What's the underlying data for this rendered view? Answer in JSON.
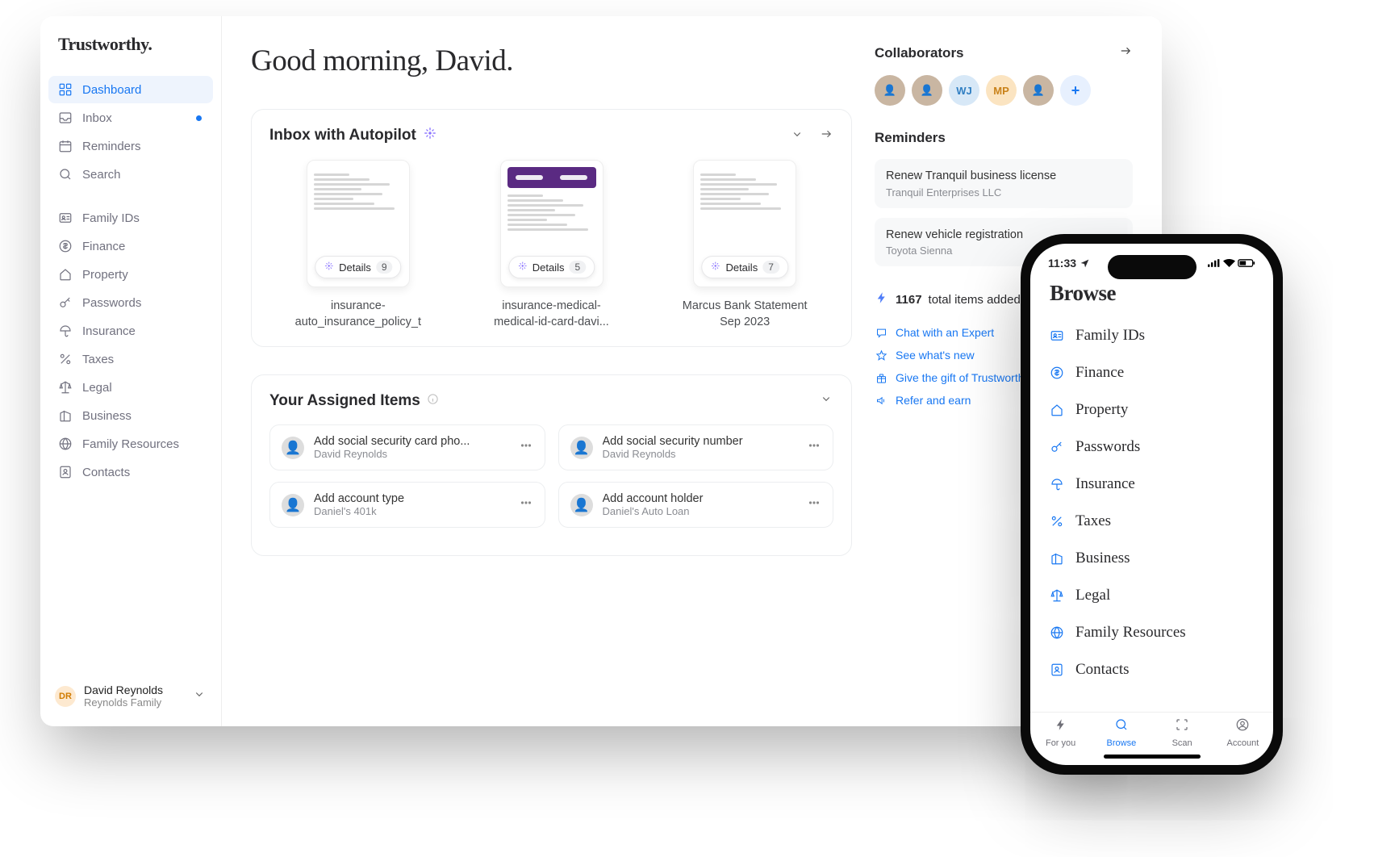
{
  "logo": "Trustworthy.",
  "sidebar": {
    "groups": [
      [
        {
          "icon": "grid",
          "label": "Dashboard",
          "active": true
        },
        {
          "icon": "inbox",
          "label": "Inbox",
          "dot": true
        },
        {
          "icon": "calendar",
          "label": "Reminders"
        },
        {
          "icon": "search",
          "label": "Search"
        }
      ],
      [
        {
          "icon": "id",
          "label": "Family IDs"
        },
        {
          "icon": "dollar",
          "label": "Finance"
        },
        {
          "icon": "home",
          "label": "Property"
        },
        {
          "icon": "key",
          "label": "Passwords"
        },
        {
          "icon": "umbrella",
          "label": "Insurance"
        },
        {
          "icon": "percent",
          "label": "Taxes"
        },
        {
          "icon": "scale",
          "label": "Legal"
        },
        {
          "icon": "building",
          "label": "Business"
        },
        {
          "icon": "globe",
          "label": "Family Resources"
        },
        {
          "icon": "contacts",
          "label": "Contacts"
        }
      ]
    ],
    "user": {
      "initials": "DR",
      "name": "David Reynolds",
      "sub": "Reynolds Family"
    }
  },
  "greeting": "Good morning, David.",
  "inbox": {
    "title": "Inbox with Autopilot",
    "details_label": "Details",
    "docs": [
      {
        "type": "t1",
        "name": "insurance-auto_insurance_policy_t",
        "count": 9
      },
      {
        "type": "t2",
        "name": "insurance-medical-medical-id-card-davi...",
        "count": 5
      },
      {
        "type": "t1",
        "name": "Marcus Bank Statement Sep 2023",
        "count": 7
      }
    ]
  },
  "assigned": {
    "title": "Your Assigned Items",
    "items": [
      {
        "title": "Add social security card pho...",
        "sub": "David Reynolds"
      },
      {
        "title": "Add social security number",
        "sub": "David Reynolds"
      },
      {
        "title": "Add account type",
        "sub": "Daniel's 401k"
      },
      {
        "title": "Add account holder",
        "sub": "Daniel's Auto Loan"
      }
    ]
  },
  "right": {
    "collaborators_title": "Collaborators",
    "collaborators": [
      {
        "type": "photo"
      },
      {
        "type": "photo"
      },
      {
        "type": "c1",
        "text": "WJ"
      },
      {
        "type": "c2",
        "text": "MP"
      },
      {
        "type": "photo"
      }
    ],
    "reminders_title": "Reminders",
    "reminders": [
      {
        "t": "Renew Tranquil business license",
        "s": "Tranquil Enterprises LLC"
      },
      {
        "t": "Renew vehicle registration",
        "s": "Toyota Sienna"
      }
    ],
    "stats": {
      "num": "1167",
      "text": "total items added"
    },
    "links": [
      {
        "icon": "chat",
        "text": "Chat with an Expert"
      },
      {
        "icon": "star",
        "text": "See what's new"
      },
      {
        "icon": "gift",
        "text": "Give the gift of Trustworthy"
      },
      {
        "icon": "speaker",
        "text": "Refer and earn"
      }
    ]
  },
  "phone": {
    "time": "11:33",
    "title": "Browse",
    "items": [
      {
        "icon": "id",
        "label": "Family IDs"
      },
      {
        "icon": "dollar",
        "label": "Finance"
      },
      {
        "icon": "home",
        "label": "Property"
      },
      {
        "icon": "key",
        "label": "Passwords"
      },
      {
        "icon": "umbrella",
        "label": "Insurance"
      },
      {
        "icon": "percent",
        "label": "Taxes"
      },
      {
        "icon": "building",
        "label": "Business"
      },
      {
        "icon": "scale",
        "label": "Legal"
      },
      {
        "icon": "globe",
        "label": "Family Resources"
      },
      {
        "icon": "contacts",
        "label": "Contacts"
      }
    ],
    "tabs": [
      {
        "icon": "bolt",
        "label": "For you"
      },
      {
        "icon": "search",
        "label": "Browse",
        "active": true
      },
      {
        "icon": "scan",
        "label": "Scan"
      },
      {
        "icon": "user",
        "label": "Account"
      }
    ]
  }
}
